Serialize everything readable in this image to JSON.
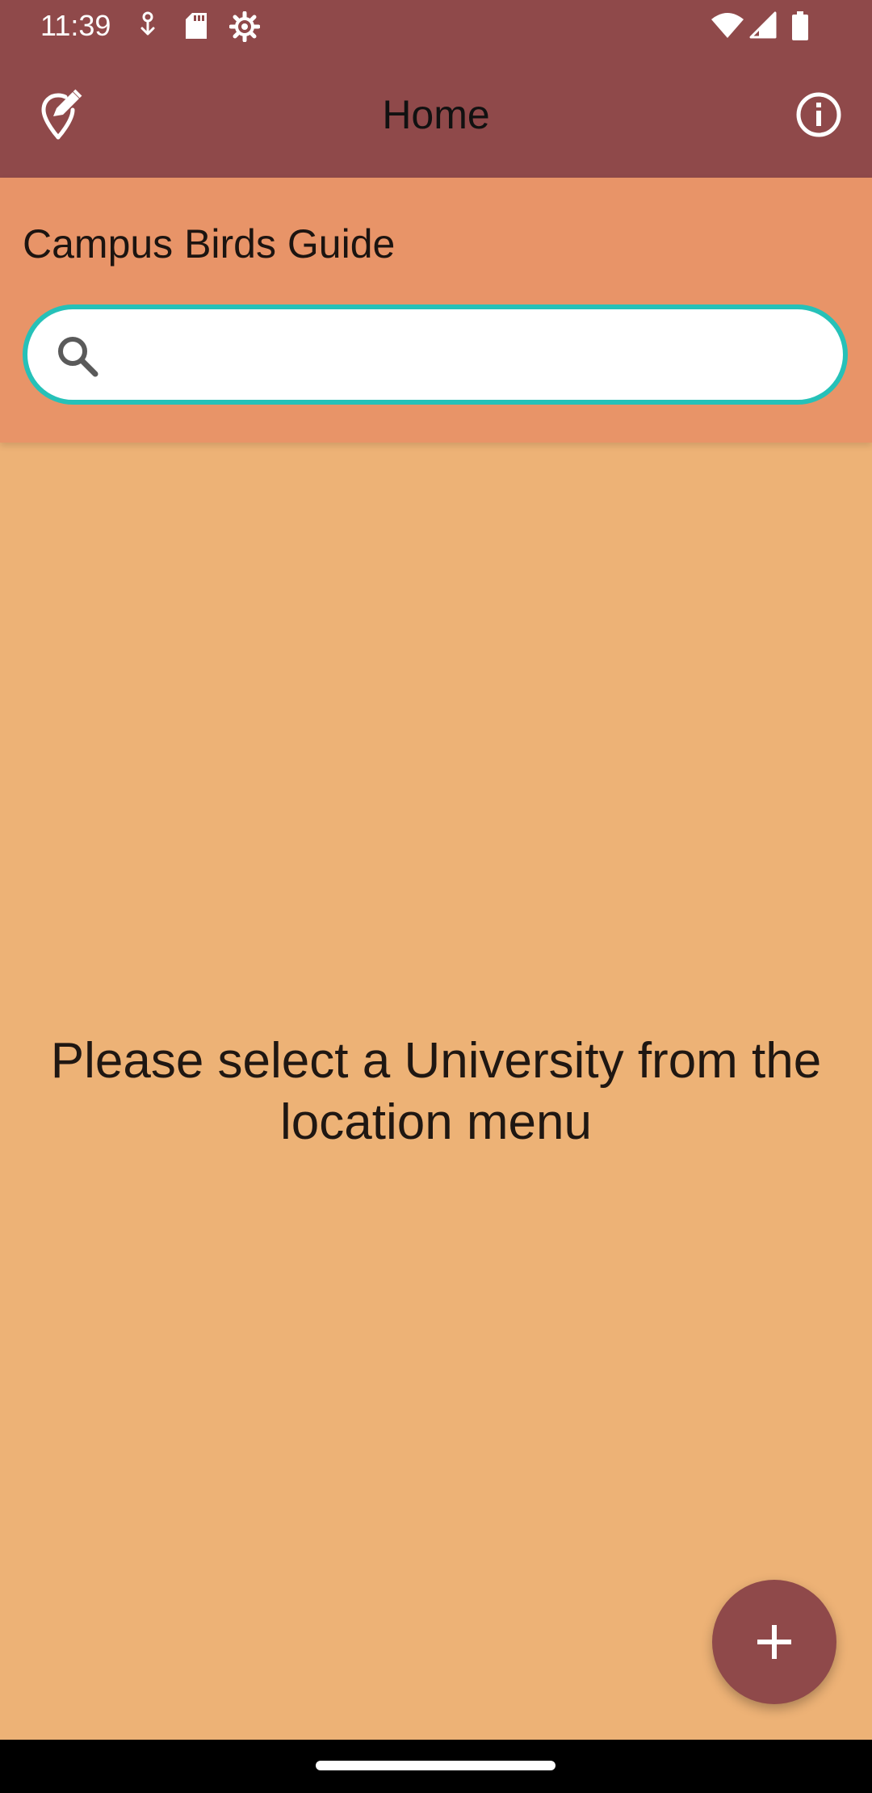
{
  "status_bar": {
    "time": "11:39",
    "left_icons": [
      "download-icon",
      "sd-card-icon",
      "gear-icon"
    ],
    "right_icons": [
      "wifi-icon",
      "signal-icon",
      "battery-icon"
    ]
  },
  "app_bar": {
    "title": "Home",
    "left_icon": "location-edit-icon",
    "right_icon": "info-icon",
    "color": "#8f494a"
  },
  "header": {
    "title": "Campus Birds Guide",
    "background_color": "#e89468",
    "search": {
      "value": "",
      "placeholder": "",
      "border_color": "#26c1b8"
    }
  },
  "main": {
    "empty_message": "Please select a University from the location menu",
    "background_color": "#edb276"
  },
  "fab": {
    "icon": "plus-icon",
    "color": "#8f494a"
  }
}
